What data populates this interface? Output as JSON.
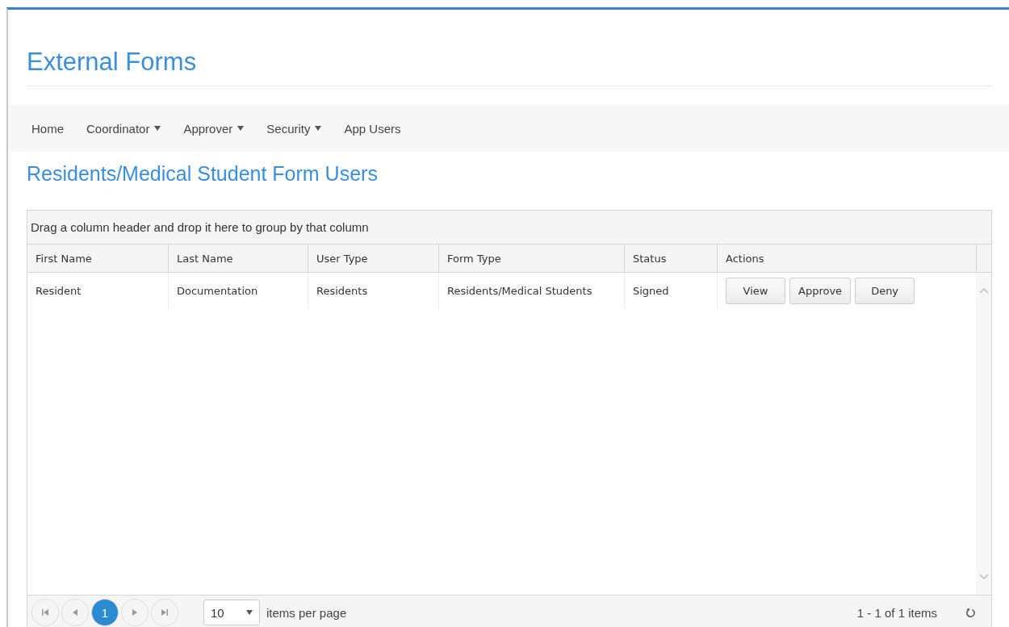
{
  "app_title": "External Forms",
  "nav": [
    {
      "label": "Home",
      "has_menu": false
    },
    {
      "label": "Coordinator",
      "has_menu": true
    },
    {
      "label": "Approver",
      "has_menu": true
    },
    {
      "label": "Security",
      "has_menu": true
    },
    {
      "label": "App Users",
      "has_menu": false
    }
  ],
  "page_title": "Residents/Medical Student Form Users",
  "grid": {
    "group_hint": "Drag a column header and drop it here to group by that column",
    "columns": [
      "First Name",
      "Last Name",
      "User Type",
      "Form Type",
      "Status",
      "Actions"
    ],
    "rows": [
      {
        "cells": [
          "Resident",
          "Documentation",
          "Residents",
          "Residents/Medical Students",
          "Signed"
        ],
        "actions": [
          "View",
          "Approve",
          "Deny"
        ]
      }
    ],
    "pager": {
      "pages": [
        {
          "label": "1",
          "selected": true
        }
      ],
      "page_size": "10",
      "page_size_label": "items per page",
      "info": "1 - 1 of 1 items"
    }
  }
}
